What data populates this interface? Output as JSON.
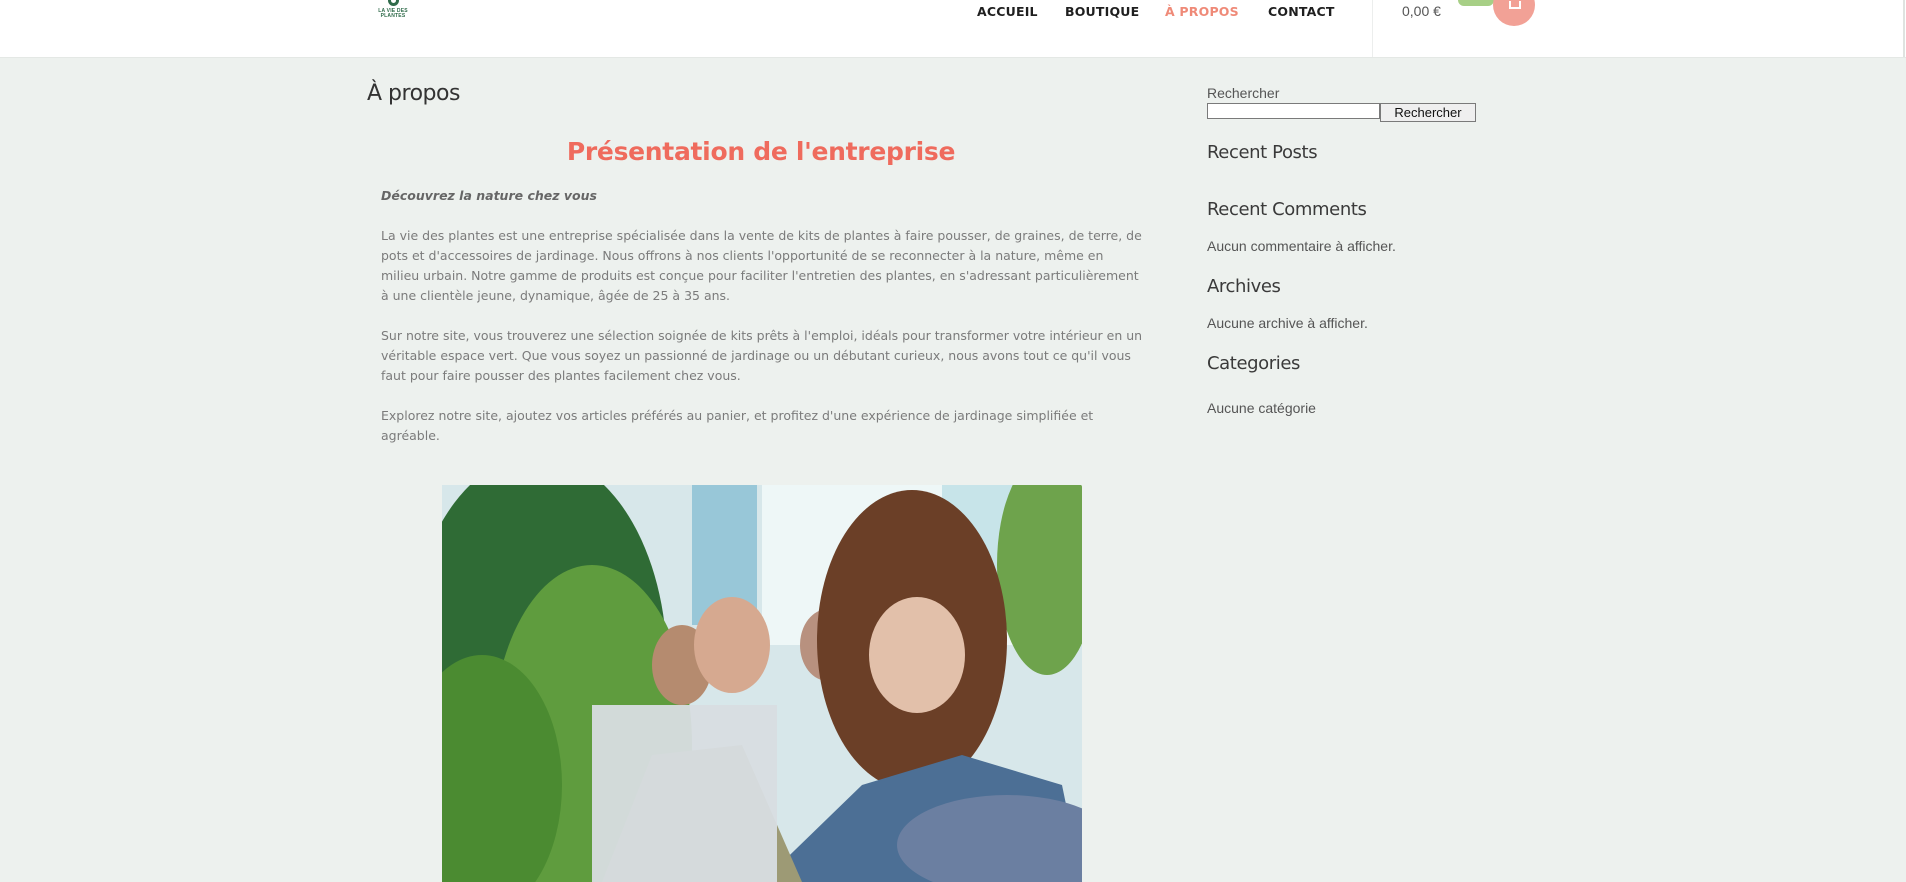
{
  "header": {
    "logo_text": "LA VIE DES PLANTES",
    "nav": [
      {
        "label": "ACCUEIL",
        "active": false
      },
      {
        "label": "BOUTIQUE",
        "active": false
      },
      {
        "label": "À PROPOS",
        "active": true
      },
      {
        "label": "CONTACT",
        "active": false
      }
    ],
    "cart_total": "0,00 €",
    "cart_icon": "cart-icon"
  },
  "main": {
    "page_title": "À propos",
    "section_title": "Présentation de l'entreprise",
    "intro": "Découvrez la nature chez vous",
    "paragraphs": [
      "La vie des plantes est une entreprise spécialisée dans la vente de kits de plantes à faire pousser, de graines, de terre, de pots et d'accessoires de jardinage. Nous offrons à nos clients l'opportunité de se reconnecter à la nature, même en milieu urbain. Notre gamme de produits est conçue pour faciliter l'entretien des plantes, en s'adressant particulièrement à une clientèle jeune, dynamique, âgée de 25 à 35 ans.",
      "Sur notre site, vous trouverez une sélection soignée de kits prêts à l'emploi, idéals pour transformer votre intérieur en un véritable espace vert. Que vous soyez un passionné de jardinage ou un débutant curieux, nous avons tout ce qu'il vous faut pour faire pousser des plantes facilement chez vous.",
      "Explorez notre site, ajoutez vos articles préférés au panier, et profitez d'une expérience de jardinage simplifiée et agréable."
    ]
  },
  "sidebar": {
    "search_label": "Rechercher",
    "search_value": "",
    "search_button": "Rechercher",
    "recent_posts_title": "Recent Posts",
    "recent_comments_title": "Recent Comments",
    "recent_comments_empty": "Aucun commentaire à afficher.",
    "archives_title": "Archives",
    "archives_empty": "Aucune archive à afficher.",
    "categories_title": "Categories",
    "categories_empty": "Aucune catégorie"
  },
  "colors": {
    "background": "#edf1ee",
    "accent": "#ef6b5d",
    "nav_active": "#ef8a78",
    "cart_button": "#f2a196",
    "cart_badge": "#a7cf86"
  }
}
